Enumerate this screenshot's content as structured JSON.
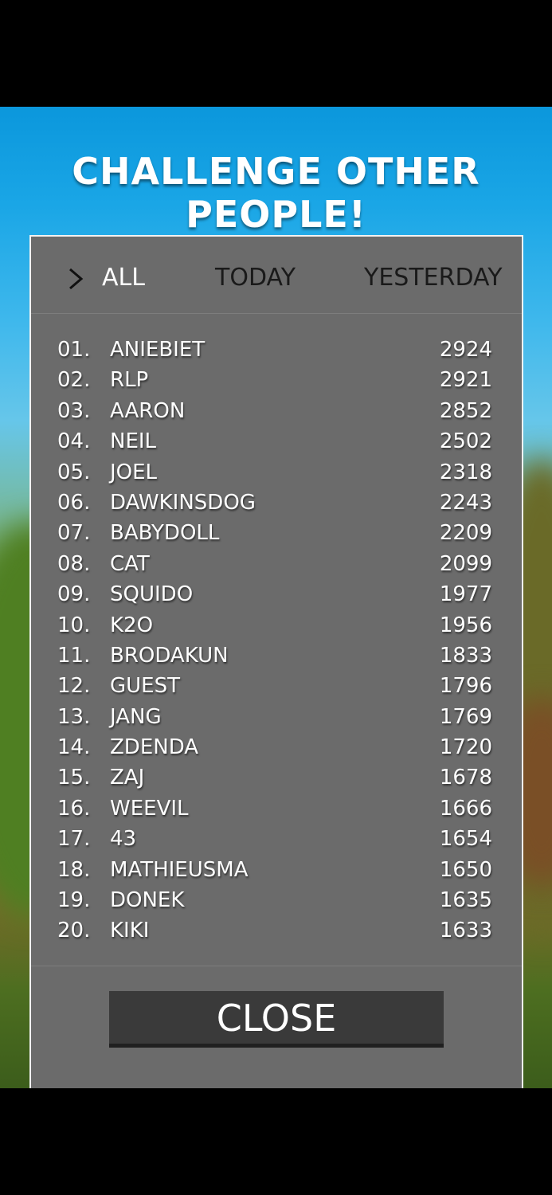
{
  "title": "CHALLENGE OTHER PEOPLE!",
  "tabs": [
    {
      "label": "ALL",
      "active": true
    },
    {
      "label": "TODAY",
      "active": false
    },
    {
      "label": "YESTERDAY",
      "active": false
    }
  ],
  "leaderboard": [
    {
      "rank": "01.",
      "name": "ANIEBIET",
      "score": "2924"
    },
    {
      "rank": "02.",
      "name": "RLP",
      "score": "2921"
    },
    {
      "rank": "03.",
      "name": "AARON",
      "score": "2852"
    },
    {
      "rank": "04.",
      "name": "NEIL",
      "score": "2502"
    },
    {
      "rank": "05.",
      "name": "JOEL",
      "score": "2318"
    },
    {
      "rank": "06.",
      "name": "DAWKINSDOG",
      "score": "2243"
    },
    {
      "rank": "07.",
      "name": "BABYDOLL",
      "score": "2209"
    },
    {
      "rank": "08.",
      "name": "CAT",
      "score": "2099"
    },
    {
      "rank": "09.",
      "name": "SQUIDO",
      "score": "1977"
    },
    {
      "rank": "10.",
      "name": "K2O",
      "score": "1956"
    },
    {
      "rank": "11.",
      "name": "BRODAKUN",
      "score": "1833"
    },
    {
      "rank": "12.",
      "name": "GUEST",
      "score": "1796"
    },
    {
      "rank": "13.",
      "name": "JANG",
      "score": "1769"
    },
    {
      "rank": "14.",
      "name": "ZDENDA",
      "score": "1720"
    },
    {
      "rank": "15.",
      "name": "ZAJ",
      "score": "1678"
    },
    {
      "rank": "16.",
      "name": "WEEVIL",
      "score": "1666"
    },
    {
      "rank": "17.",
      "name": "43",
      "score": "1654"
    },
    {
      "rank": "18.",
      "name": "MATHIEUSMA",
      "score": "1650"
    },
    {
      "rank": "19.",
      "name": "DONEK",
      "score": "1635"
    },
    {
      "rank": "20.",
      "name": "KIKI",
      "score": "1633"
    }
  ],
  "close_label": "CLOSE",
  "icons": {
    "tab_indicator": "chevron-right-icon"
  },
  "colors": {
    "sky": "#0b97dc",
    "panel": "#6b6b6b",
    "button": "#3a3a3a"
  }
}
